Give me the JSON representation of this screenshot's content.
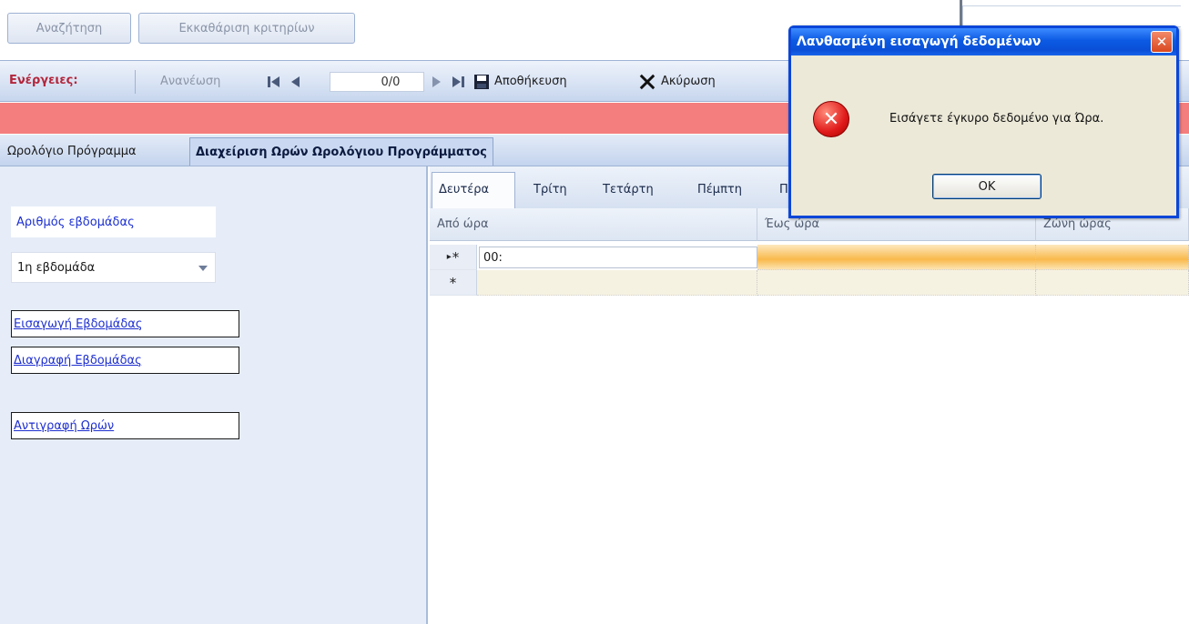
{
  "search": {
    "search_label": "Αναζήτηση",
    "clear_label": "Εκκαθάριση κριτηρίων"
  },
  "toolbar": {
    "title": "Ενέργειες:",
    "refresh_label": "Ανανέωση",
    "record_position": "0/0",
    "save_label": "Αποθήκευση",
    "cancel_label": "Ακύρωση"
  },
  "tabs": [
    {
      "label": "Ωρολόγιο Πρόγραμμα",
      "active": false
    },
    {
      "label": "Διαχείριση Ωρών Ωρολόγιου Προγράμματος",
      "active": true
    }
  ],
  "left_panel": {
    "week_label": "Αριθμός εβδομάδας",
    "week_selected": "1η εβδομάδα",
    "links": [
      "Εισαγωγή Εβδομάδας",
      "Διαγραφή Εβδομάδας",
      "Αντιγραφή Ωρών"
    ]
  },
  "day_tabs": [
    "Δευτέρα",
    "Τρίτη",
    "Τετάρτη",
    "Πέμπτη",
    "Π"
  ],
  "grid": {
    "columns": [
      "Από ώρα",
      "Έως ώρα",
      "Ζώνη ώρας"
    ],
    "rows": [
      {
        "marker": "*",
        "from_value": "00:"
      },
      {
        "marker": "*",
        "from_value": ""
      }
    ]
  },
  "dialog": {
    "title": "Λανθασμένη εισαγωγή δεδομένων",
    "message": "Εισάγετε έγκυρο δεδομένο για Ώρα.",
    "ok_label": "OK",
    "close_glyph": "✕",
    "icon": "error-icon"
  },
  "colors": {
    "accent_red": "#f47e7e",
    "title_red": "#b3263b",
    "link_blue": "#1e2fcf",
    "dialog_title_blue": "#0c5ae3"
  }
}
